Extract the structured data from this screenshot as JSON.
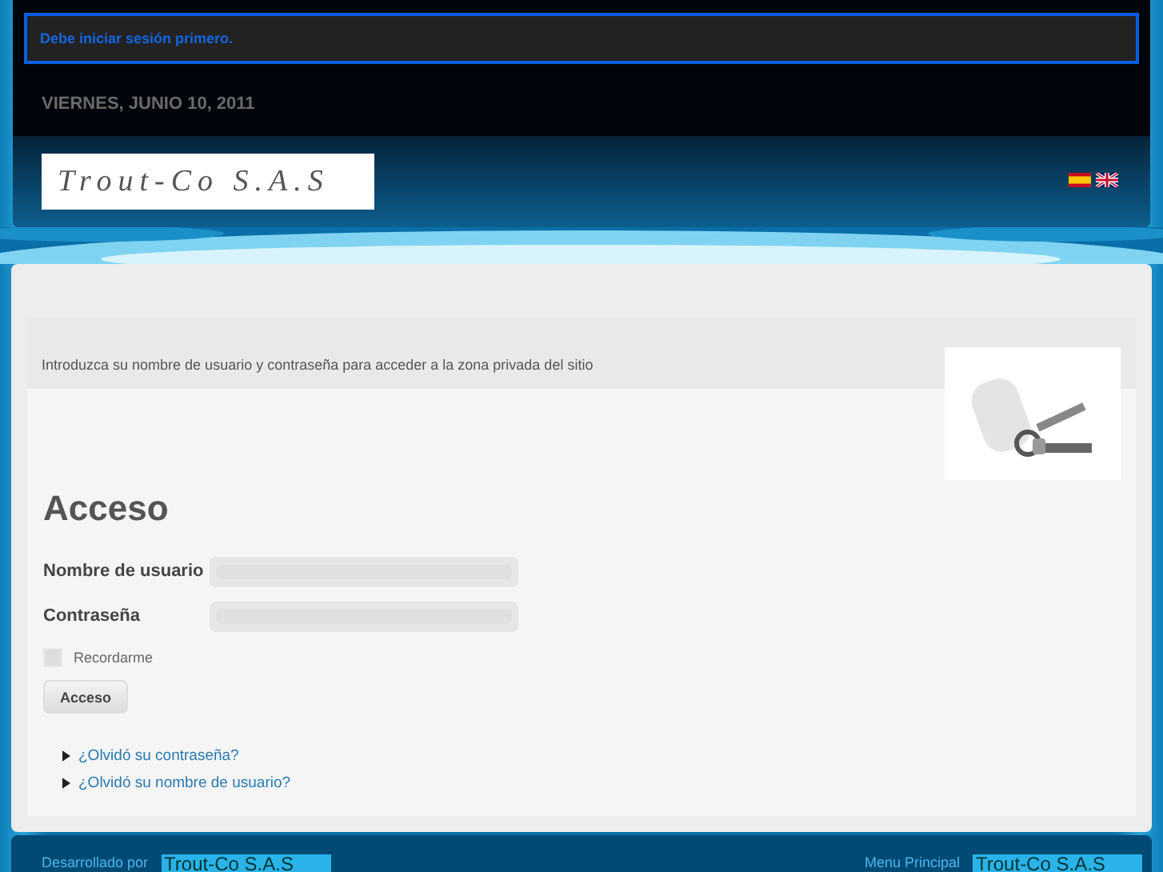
{
  "alert": {
    "message": "Debe iniciar sesión primero."
  },
  "date": "VIERNES, JUNIO 10, 2011",
  "header": {
    "logo": "Trout-Co S.A.S",
    "languages": [
      {
        "kind": "es"
      },
      {
        "kind": "en"
      }
    ]
  },
  "intro": "Introduzca su nombre de usuario y contraseña para acceder a la zona privada del sitio",
  "login": {
    "title": "Acceso",
    "fields": [
      {
        "label": "Nombre de usuario"
      },
      {
        "label": "Contraseña"
      }
    ],
    "remember": {
      "label": "Recordarme",
      "checked": false
    },
    "button": "Acceso",
    "links": [
      "¿Olvidó su contraseña?",
      "¿Olvidó su nombre de usuario?"
    ]
  },
  "footer": {
    "developed_by": "Desarrollado por",
    "developer_logo": "Trout-Co S.A.S",
    "menu_label": "Menu Principal",
    "menu_logo": "Trout-Co S.A.S"
  }
}
